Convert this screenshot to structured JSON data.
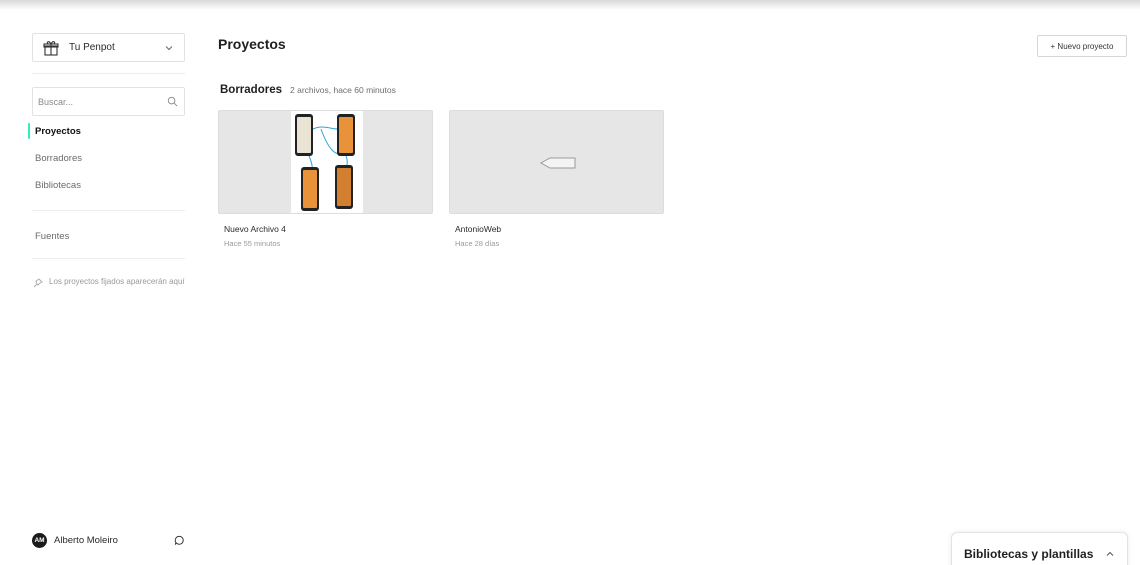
{
  "sidebar": {
    "team_label": "Tu Penpot",
    "search_placeholder": "Buscar...",
    "nav": {
      "projects": "Proyectos",
      "drafts": "Borradores",
      "libraries": "Bibliotecas",
      "fonts": "Fuentes"
    },
    "pinned_hint": "Los proyectos fijados aparecerán aquí",
    "user": {
      "initials": "AM",
      "name": "Alberto Moleiro"
    }
  },
  "main": {
    "title": "Proyectos",
    "new_project_label": "+ Nuevo proyecto",
    "section": {
      "name": "Borradores",
      "meta": "2 archivos, hace 60 minutos"
    },
    "files": [
      {
        "name": "Nuevo Archivo 4",
        "date": "Hace 55 minutos"
      },
      {
        "name": "AntonioWeb",
        "date": "Hace 28 días"
      }
    ]
  },
  "libraries_panel": {
    "title": "Bibliotecas y plantillas"
  },
  "colors": {
    "accent": "#31efb8",
    "thumb_bg": "#e6e6e6",
    "phone_screen_orange": "#e8933a",
    "phone_screen_teal": "#2f8f8f"
  },
  "icons": {
    "team": "gift-icon",
    "team_dropdown": "chevron-down-icon",
    "search": "search-icon",
    "pin": "pin-icon",
    "chat": "chat-icon",
    "panel_toggle": "chevron-up-icon"
  }
}
